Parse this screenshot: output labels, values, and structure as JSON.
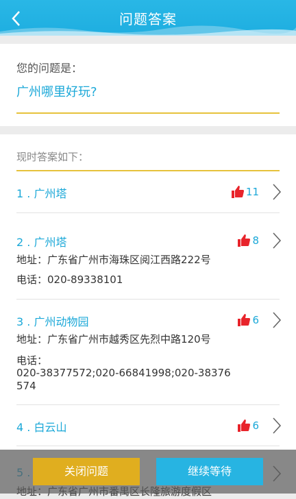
{
  "header": {
    "title": "问题答案",
    "back_icon": "chevron-left-icon"
  },
  "question": {
    "label": "您的问题是：",
    "text": "广州哪里好玩?"
  },
  "answers_heading": "现时答案如下：",
  "answers": [
    {
      "name": "1 . 广州塔",
      "likes": "11",
      "address": "",
      "phone": ""
    },
    {
      "name": "2 . 广州塔",
      "likes": "8",
      "address": "地址：广东省广州市海珠区阅江西路222号",
      "phone": "电话：020-89338101"
    },
    {
      "name": "3 . 广州动物园",
      "likes": "6",
      "address": "地址：广东省广州市越秀区先烈中路120号",
      "phone_label": "电话：",
      "phone_line1": "020-38377572;020-66841998;020-38376",
      "phone_line2": "574"
    },
    {
      "name": "4 . 白云山",
      "likes": "6"
    },
    {
      "name": "5 .",
      "address_partial": "地址：广东省广州市番禺区长隆旅游度假区"
    }
  ],
  "buttons": {
    "close": "关闭问题",
    "wait": "继续等待"
  },
  "colors": {
    "accent": "#1ba8d8",
    "like_red": "#e8242b",
    "gold": "#e0ae1f"
  }
}
